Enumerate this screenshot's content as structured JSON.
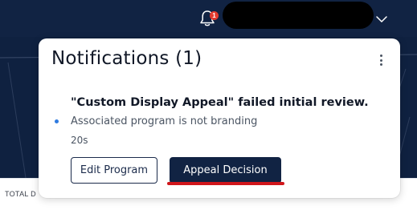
{
  "header": {
    "notification_badge_count": "1",
    "icons": [
      "bell-icon",
      "chevron-down-icon"
    ],
    "background_color": "#112343"
  },
  "notifications_panel": {
    "title": "Notifications (1)",
    "menu_icon": "kebab-menu-icon",
    "items": [
      {
        "title": "\"Custom Display Appeal\" failed initial review.",
        "description": "Associated program is not branding",
        "time": "20s",
        "unread": true,
        "actions": {
          "edit_label": "Edit Program",
          "appeal_label": "Appeal Decision"
        }
      }
    ]
  },
  "stats": {
    "label": "TOTAL D"
  },
  "colors": {
    "navy": "#112343",
    "badge_red": "#e23a2e",
    "unread_dot": "#2f7be0",
    "highlight_red": "#d0161b"
  }
}
